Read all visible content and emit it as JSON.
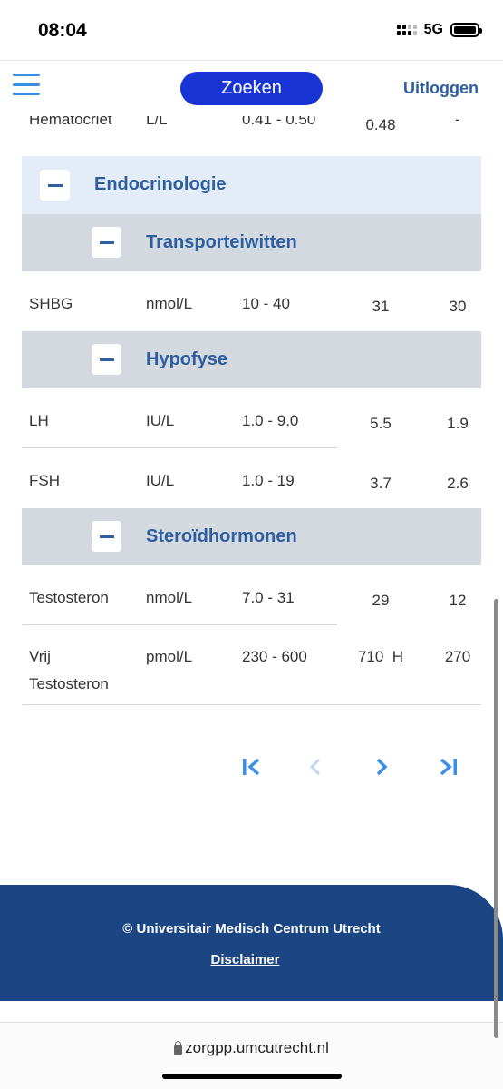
{
  "status_bar": {
    "time": "08:04",
    "network": "5G"
  },
  "header": {
    "search_label": "Zoeken",
    "logout_label": "Uitloggen"
  },
  "partial_row": {
    "name": "Hematocriet",
    "unit": "L/L",
    "range": "0.41 - 0.50",
    "value1": "0.48",
    "value2": "-"
  },
  "group": {
    "label": "Endocrinologie"
  },
  "sections": [
    {
      "label": "Transporteiwitten",
      "rows": [
        {
          "name": "SHBG",
          "unit": "nmol/L",
          "range": "10 - 40",
          "value1": "31",
          "value2": "30"
        }
      ]
    },
    {
      "label": "Hypofyse",
      "rows": [
        {
          "name": "LH",
          "unit": "IU/L",
          "range": "1.0 - 9.0",
          "value1": "5.5",
          "value2": "1.9"
        },
        {
          "name": "FSH",
          "unit": "IU/L",
          "range": "1.0 - 19",
          "value1": "3.7",
          "value2": "2.6"
        }
      ]
    },
    {
      "label": "Steroïdhormonen",
      "rows": [
        {
          "name": "Testosteron",
          "unit": "nmol/L",
          "range": "7.0 - 31",
          "value1": "29",
          "value2": "12"
        },
        {
          "name_line1": "Vrij",
          "name_line2": "Testosteron",
          "unit": "pmol/L",
          "range": "230 - 600",
          "value1": "710  H",
          "value2": "270"
        }
      ]
    }
  ],
  "pagination": {
    "first": "first-page",
    "prev": "previous-page",
    "next": "next-page",
    "last": "last-page"
  },
  "colors": {
    "accent": "#1834d4",
    "brand_blue": "#2d5e9f",
    "footer": "#1b4583",
    "pager_active": "#3a8ee6",
    "pager_disabled": "#c2d6ef"
  },
  "footer": {
    "copyright": "© Universitair Medisch Centrum Utrecht",
    "disclaimer": "Disclaimer"
  },
  "browser": {
    "url": "zorgpp.umcutrecht.nl"
  }
}
